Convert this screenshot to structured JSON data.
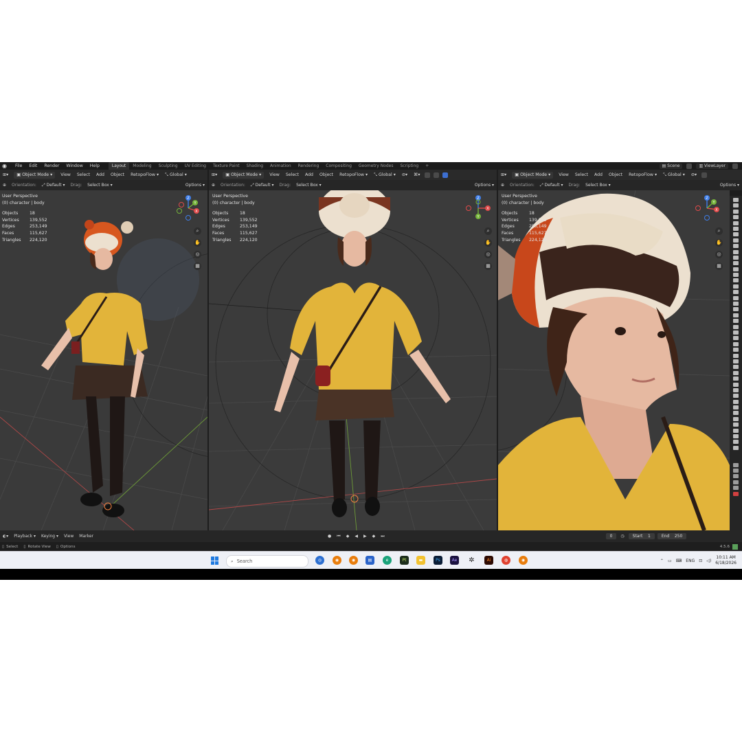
{
  "topbar": {
    "menus": [
      "File",
      "Edit",
      "Render",
      "Window",
      "Help"
    ],
    "workspaces": [
      "Layout",
      "Modeling",
      "Sculpting",
      "UV Editing",
      "Texture Paint",
      "Shading",
      "Animation",
      "Rendering",
      "Compositing",
      "Geometry Nodes",
      "Scripting"
    ],
    "active_workspace": "Layout",
    "add_tab": "+",
    "scene_label": "Scene",
    "view_layer_label": "ViewLayer"
  },
  "viewport_header": {
    "mode": "Object Mode",
    "menus": [
      "View",
      "Select",
      "Add",
      "Object"
    ],
    "addon": "RetopoFlow",
    "transform_space": "Global",
    "orientation_label": "Orientation:",
    "orientation_value": "Default",
    "drag_label": "Drag:",
    "drag_value": "Select Box",
    "options": "Options"
  },
  "viewports": [
    {
      "perspective": "User Perspective",
      "object": "(0) character | body",
      "stats": [
        {
          "label": "Objects",
          "value": "18"
        },
        {
          "label": "Vertices",
          "value": "139,552"
        },
        {
          "label": "Edges",
          "value": "253,149"
        },
        {
          "label": "Faces",
          "value": "115,627"
        },
        {
          "label": "Triangles",
          "value": "224,120"
        }
      ]
    },
    {
      "perspective": "User Perspective",
      "object": "(0) character | body",
      "stats": [
        {
          "label": "Objects",
          "value": "18"
        },
        {
          "label": "Vertices",
          "value": "139,552"
        },
        {
          "label": "Edges",
          "value": "253,149"
        },
        {
          "label": "Faces",
          "value": "115,627"
        },
        {
          "label": "Triangles",
          "value": "224,120"
        }
      ]
    },
    {
      "perspective": "User Perspective",
      "object": "(0) character | body",
      "stats": [
        {
          "label": "Objects",
          "value": "18"
        },
        {
          "label": "Vertices",
          "value": "139,552"
        },
        {
          "label": "Edges",
          "value": "253,149"
        },
        {
          "label": "Faces",
          "value": "115,627"
        },
        {
          "label": "Triangles",
          "value": "224,120"
        }
      ]
    }
  ],
  "gizmo_axes": {
    "x": "X",
    "y": "Y",
    "z": "Z"
  },
  "timeline": {
    "menus": [
      "Playback",
      "Keying",
      "View",
      "Marker"
    ],
    "current_frame": "0",
    "start_label": "Start",
    "start_value": "1",
    "end_label": "End",
    "end_value": "250"
  },
  "status_bar": {
    "items": [
      "Select",
      "Rotate View",
      "Options"
    ],
    "version": "4.5.6"
  },
  "taskbar": {
    "search_placeholder": "Search",
    "apps": [
      "Pt",
      "Ps",
      "Ae",
      "Ai"
    ],
    "language": "ENG",
    "time": "10:11 AM",
    "date": "6/18/2026"
  },
  "colors": {
    "x_axis": "#e04a4a",
    "y_axis": "#76b43a",
    "z_axis": "#3f7ee8",
    "sweater": "#e2b43a",
    "hat_orange": "#d7571f"
  }
}
